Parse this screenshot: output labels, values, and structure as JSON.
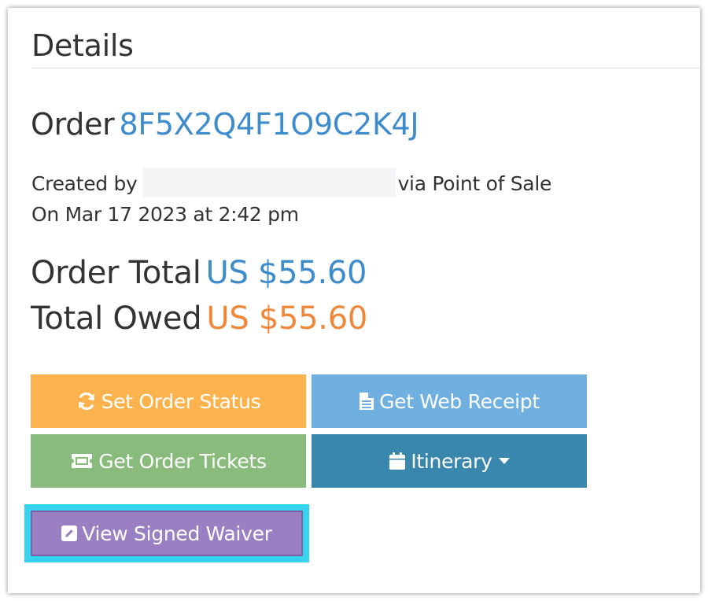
{
  "panel": {
    "title": "Details"
  },
  "order": {
    "label": "Order",
    "id": "8F5X2Q4F1O9C2K4J",
    "created_prefix": "Created by",
    "created_suffix": "via Point of Sale",
    "created_on": "On Mar 17 2023 at 2:42 pm"
  },
  "totals": {
    "order_total_label": "Order Total",
    "order_total_value": "US $55.60",
    "total_owed_label": "Total Owed",
    "total_owed_value": "US $55.60"
  },
  "buttons": {
    "set_status": "Set Order Status",
    "web_receipt": "Get Web Receipt",
    "order_tickets": "Get Order Tickets",
    "itinerary": "Itinerary",
    "view_waiver": "View Signed Waiver"
  },
  "colors": {
    "link_blue": "#3f8ccd",
    "owed_orange": "#f0883b",
    "status_orange": "#fdb34d",
    "receipt_blue": "#6fb0e0",
    "tickets_green": "#88bb7c",
    "itinerary_blue": "#3a87ad",
    "waiver_purple": "#9a80c2",
    "highlight_cyan": "#36d3ee"
  },
  "icons": {
    "set_status": "refresh-icon",
    "web_receipt": "file-text-icon",
    "order_tickets": "ticket-icon",
    "itinerary": "calendar-icon",
    "itinerary_caret": "caret-down-icon",
    "view_waiver": "edit-icon"
  }
}
